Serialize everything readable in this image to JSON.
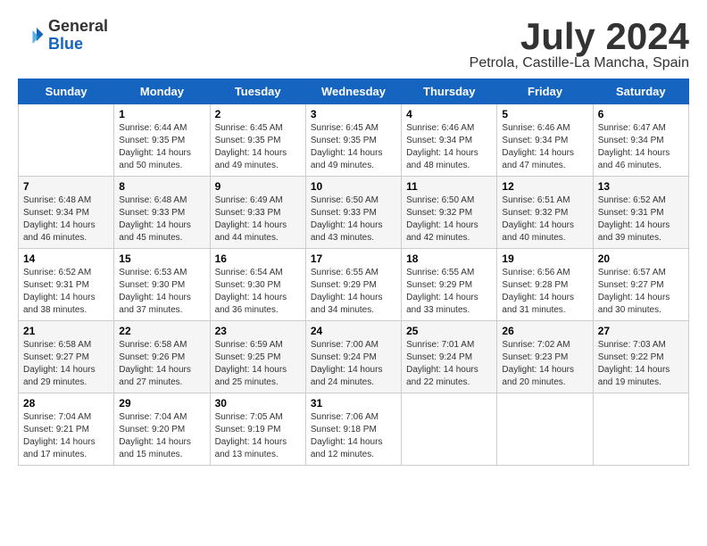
{
  "header": {
    "logo": {
      "general": "General",
      "blue": "Blue"
    },
    "month_title": "July 2024",
    "location": "Petrola, Castille-La Mancha, Spain"
  },
  "days_of_week": [
    "Sunday",
    "Monday",
    "Tuesday",
    "Wednesday",
    "Thursday",
    "Friday",
    "Saturday"
  ],
  "weeks": [
    [
      {
        "day": "",
        "info": ""
      },
      {
        "day": "1",
        "info": "Sunrise: 6:44 AM\nSunset: 9:35 PM\nDaylight: 14 hours\nand 50 minutes."
      },
      {
        "day": "2",
        "info": "Sunrise: 6:45 AM\nSunset: 9:35 PM\nDaylight: 14 hours\nand 49 minutes."
      },
      {
        "day": "3",
        "info": "Sunrise: 6:45 AM\nSunset: 9:35 PM\nDaylight: 14 hours\nand 49 minutes."
      },
      {
        "day": "4",
        "info": "Sunrise: 6:46 AM\nSunset: 9:34 PM\nDaylight: 14 hours\nand 48 minutes."
      },
      {
        "day": "5",
        "info": "Sunrise: 6:46 AM\nSunset: 9:34 PM\nDaylight: 14 hours\nand 47 minutes."
      },
      {
        "day": "6",
        "info": "Sunrise: 6:47 AM\nSunset: 9:34 PM\nDaylight: 14 hours\nand 46 minutes."
      }
    ],
    [
      {
        "day": "7",
        "info": "Sunrise: 6:48 AM\nSunset: 9:34 PM\nDaylight: 14 hours\nand 46 minutes."
      },
      {
        "day": "8",
        "info": "Sunrise: 6:48 AM\nSunset: 9:33 PM\nDaylight: 14 hours\nand 45 minutes."
      },
      {
        "day": "9",
        "info": "Sunrise: 6:49 AM\nSunset: 9:33 PM\nDaylight: 14 hours\nand 44 minutes."
      },
      {
        "day": "10",
        "info": "Sunrise: 6:50 AM\nSunset: 9:33 PM\nDaylight: 14 hours\nand 43 minutes."
      },
      {
        "day": "11",
        "info": "Sunrise: 6:50 AM\nSunset: 9:32 PM\nDaylight: 14 hours\nand 42 minutes."
      },
      {
        "day": "12",
        "info": "Sunrise: 6:51 AM\nSunset: 9:32 PM\nDaylight: 14 hours\nand 40 minutes."
      },
      {
        "day": "13",
        "info": "Sunrise: 6:52 AM\nSunset: 9:31 PM\nDaylight: 14 hours\nand 39 minutes."
      }
    ],
    [
      {
        "day": "14",
        "info": "Sunrise: 6:52 AM\nSunset: 9:31 PM\nDaylight: 14 hours\nand 38 minutes."
      },
      {
        "day": "15",
        "info": "Sunrise: 6:53 AM\nSunset: 9:30 PM\nDaylight: 14 hours\nand 37 minutes."
      },
      {
        "day": "16",
        "info": "Sunrise: 6:54 AM\nSunset: 9:30 PM\nDaylight: 14 hours\nand 36 minutes."
      },
      {
        "day": "17",
        "info": "Sunrise: 6:55 AM\nSunset: 9:29 PM\nDaylight: 14 hours\nand 34 minutes."
      },
      {
        "day": "18",
        "info": "Sunrise: 6:55 AM\nSunset: 9:29 PM\nDaylight: 14 hours\nand 33 minutes."
      },
      {
        "day": "19",
        "info": "Sunrise: 6:56 AM\nSunset: 9:28 PM\nDaylight: 14 hours\nand 31 minutes."
      },
      {
        "day": "20",
        "info": "Sunrise: 6:57 AM\nSunset: 9:27 PM\nDaylight: 14 hours\nand 30 minutes."
      }
    ],
    [
      {
        "day": "21",
        "info": "Sunrise: 6:58 AM\nSunset: 9:27 PM\nDaylight: 14 hours\nand 29 minutes."
      },
      {
        "day": "22",
        "info": "Sunrise: 6:58 AM\nSunset: 9:26 PM\nDaylight: 14 hours\nand 27 minutes."
      },
      {
        "day": "23",
        "info": "Sunrise: 6:59 AM\nSunset: 9:25 PM\nDaylight: 14 hours\nand 25 minutes."
      },
      {
        "day": "24",
        "info": "Sunrise: 7:00 AM\nSunset: 9:24 PM\nDaylight: 14 hours\nand 24 minutes."
      },
      {
        "day": "25",
        "info": "Sunrise: 7:01 AM\nSunset: 9:24 PM\nDaylight: 14 hours\nand 22 minutes."
      },
      {
        "day": "26",
        "info": "Sunrise: 7:02 AM\nSunset: 9:23 PM\nDaylight: 14 hours\nand 20 minutes."
      },
      {
        "day": "27",
        "info": "Sunrise: 7:03 AM\nSunset: 9:22 PM\nDaylight: 14 hours\nand 19 minutes."
      }
    ],
    [
      {
        "day": "28",
        "info": "Sunrise: 7:04 AM\nSunset: 9:21 PM\nDaylight: 14 hours\nand 17 minutes."
      },
      {
        "day": "29",
        "info": "Sunrise: 7:04 AM\nSunset: 9:20 PM\nDaylight: 14 hours\nand 15 minutes."
      },
      {
        "day": "30",
        "info": "Sunrise: 7:05 AM\nSunset: 9:19 PM\nDaylight: 14 hours\nand 13 minutes."
      },
      {
        "day": "31",
        "info": "Sunrise: 7:06 AM\nSunset: 9:18 PM\nDaylight: 14 hours\nand 12 minutes."
      },
      {
        "day": "",
        "info": ""
      },
      {
        "day": "",
        "info": ""
      },
      {
        "day": "",
        "info": ""
      }
    ]
  ]
}
